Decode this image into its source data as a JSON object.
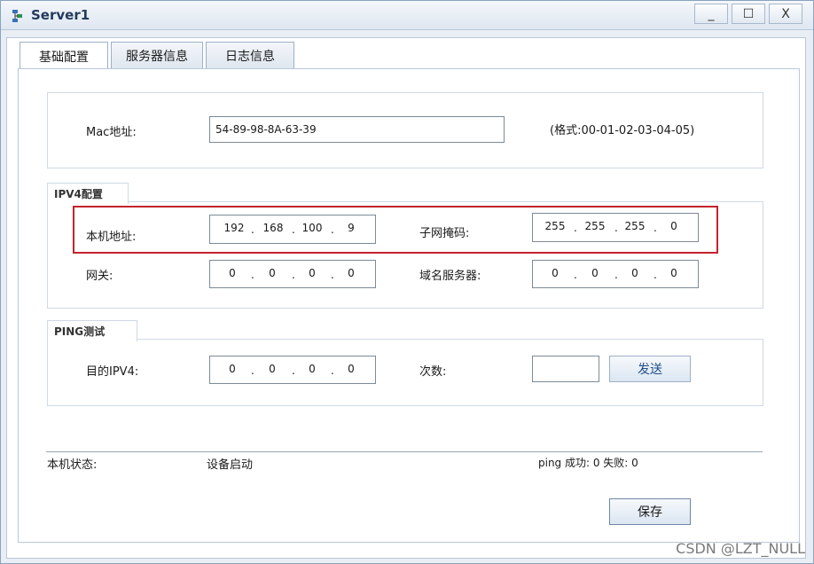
{
  "window": {
    "title": "Server1",
    "minimize_label": "_",
    "maximize_label": "☐",
    "close_label": "X"
  },
  "tabs": [
    {
      "label": "基础配置",
      "active": true
    },
    {
      "label": "服务器信息",
      "active": false
    },
    {
      "label": "日志信息",
      "active": false
    }
  ],
  "mac": {
    "label": "Mac地址:",
    "value": "54-89-98-8A-63-39",
    "hint": "(格式:00-01-02-03-04-05)"
  },
  "ipv4": {
    "group_label": "IPV4配置",
    "address": {
      "label": "本机地址:",
      "octets": [
        "192",
        "168",
        "100",
        "9"
      ]
    },
    "mask": {
      "label": "子网掩码:",
      "octets": [
        "255",
        "255",
        "255",
        "0"
      ]
    },
    "gateway": {
      "label": "网关:",
      "octets": [
        "0",
        "0",
        "0",
        "0"
      ]
    },
    "dns": {
      "label": "域名服务器:",
      "octets": [
        "0",
        "0",
        "0",
        "0"
      ]
    }
  },
  "ping": {
    "group_label": "PING测试",
    "dest": {
      "label": "目的IPV4:",
      "octets": [
        "0",
        "0",
        "0",
        "0"
      ]
    },
    "count": {
      "label": "次数:",
      "value": ""
    },
    "send_label": "发送"
  },
  "status": {
    "label": "本机状态:",
    "value": "设备启动",
    "ping_result": "ping 成功: 0 失败: 0"
  },
  "save_label": "保存",
  "watermark": "CSDN @LZT_NULL",
  "colors": {
    "highlight": "#c4232c",
    "accent": "#1f4f8a"
  }
}
